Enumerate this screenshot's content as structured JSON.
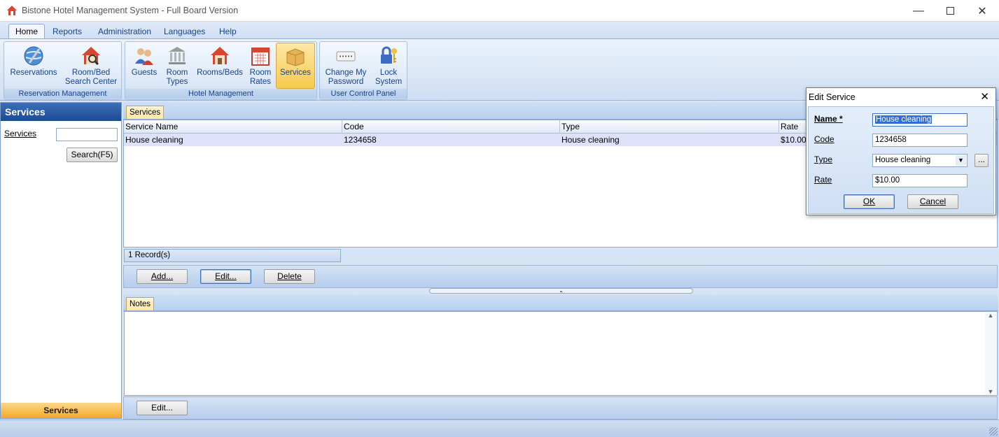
{
  "window": {
    "title": "Bistone Hotel Management System - Full Board Version"
  },
  "menu": {
    "tabs": [
      "Home",
      "Reports",
      "Administration",
      "Languages",
      "Help"
    ],
    "active": "Home"
  },
  "ribbon": {
    "groups": [
      {
        "label": "Reservation Management",
        "buttons": [
          {
            "label1": "Reservations",
            "label2": ""
          },
          {
            "label1": "Room/Bed",
            "label2": "Search Center"
          }
        ]
      },
      {
        "label": "Hotel Management",
        "buttons": [
          {
            "label1": "Guests",
            "label2": ""
          },
          {
            "label1": "Room",
            "label2": "Types"
          },
          {
            "label1": "Rooms/Beds",
            "label2": ""
          },
          {
            "label1": "Room",
            "label2": "Rates"
          },
          {
            "label1": "Services",
            "label2": ""
          }
        ]
      },
      {
        "label": "User Control Panel",
        "buttons": [
          {
            "label1": "Change My",
            "label2": "Password"
          },
          {
            "label1": "Lock",
            "label2": "System"
          }
        ]
      }
    ]
  },
  "left_panel": {
    "title": "Services",
    "search_label": "Services",
    "search_value": "",
    "search_button": "Search(F5)",
    "footer": "Services"
  },
  "services_tab": {
    "label": "Services"
  },
  "grid": {
    "columns": [
      "Service Name",
      "Code",
      "Type",
      "Rate"
    ],
    "rows": [
      {
        "name": "House cleaning",
        "code": "1234658",
        "type": "House cleaning",
        "rate": "$10.00"
      }
    ],
    "record_count": "1 Record(s)"
  },
  "actions": {
    "add": "Add...",
    "edit": "Edit...",
    "delete": "Delete"
  },
  "notes": {
    "tab": "Notes",
    "edit": "Edit..."
  },
  "dialog": {
    "title": "Edit Service",
    "name_label": "Name *",
    "name_value": "House cleaning",
    "code_label": "Code",
    "code_value": "1234658",
    "type_label": "Type",
    "type_value": "House cleaning",
    "browse_label": "...",
    "rate_label": "Rate",
    "rate_value": "$10.00",
    "ok": "OK",
    "cancel": "Cancel"
  },
  "colors": {
    "accent": "#15428b",
    "header_blue": "#1d4a94",
    "active_orange": "#f8c94f",
    "selection": "#2f6ed6"
  },
  "icons": [
    "hotel-app-icon",
    "reservations-globe-icon",
    "room-search-icon",
    "guests-icon",
    "room-types-icon",
    "rooms-beds-icon",
    "room-rates-calendar-icon",
    "services-box-icon",
    "change-password-icon",
    "lock-system-icon"
  ]
}
